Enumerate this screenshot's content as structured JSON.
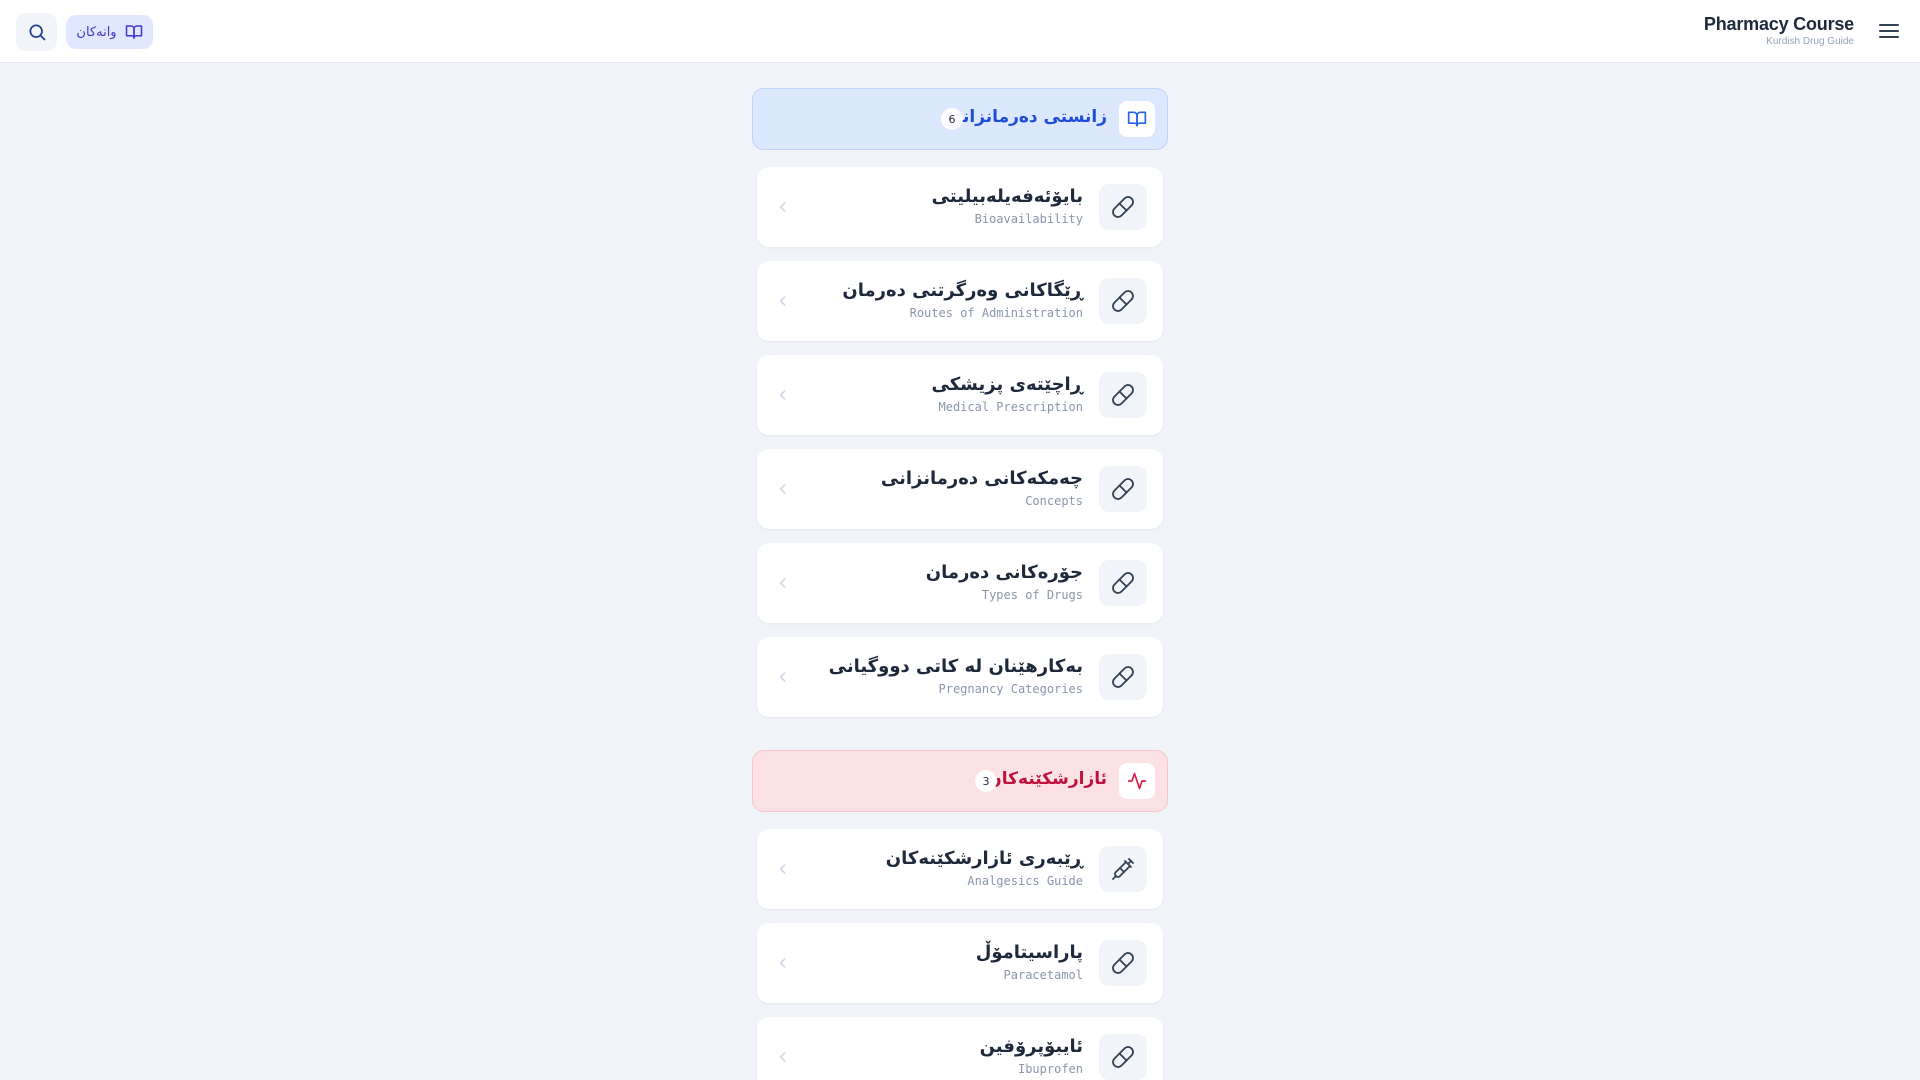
{
  "header": {
    "title": "Pharmacy Course",
    "subtitle": "Kurdish Drug Guide",
    "menu_icon": "hamburger-menu-icon",
    "lessons_label": "وانەکان",
    "lessons_icon": "open-book-icon",
    "search_icon": "search-icon"
  },
  "sections": [
    {
      "title": "زانستی دەرمانزانی",
      "count": "6",
      "icon": "open-book-icon",
      "theme_color": "#1d4ed8",
      "items": [
        {
          "title": "بایۆئەفەیلەبیلیتی",
          "subtitle": "Bioavailability",
          "icon": "pill-icon"
        },
        {
          "title": "ڕێگاکانی وەرگرتنی دەرمان",
          "subtitle": "Routes of Administration",
          "icon": "pill-icon"
        },
        {
          "title": "ڕاچێتەی پزیشکی",
          "subtitle": "Medical Prescription",
          "icon": "pill-icon"
        },
        {
          "title": "چەمکەکانی دەرمانزانی",
          "subtitle": "Concepts",
          "icon": "pill-icon"
        },
        {
          "title": "جۆرەکانی دەرمان",
          "subtitle": "Types of Drugs",
          "icon": "pill-icon"
        },
        {
          "title": "بەکارهێنان لە کاتی دووگیانی",
          "subtitle": "Pregnancy Categories",
          "icon": "pill-icon"
        }
      ]
    },
    {
      "title": "ئازارشکێنەکان",
      "count": "3",
      "icon": "activity-pulse-icon",
      "theme_color": "#be123c",
      "items": [
        {
          "title": "ڕێبەری ئازارشکێنەکان",
          "subtitle": "Analgesics Guide",
          "icon": "syringe-icon"
        },
        {
          "title": "پاراسیتامۆڵ",
          "subtitle": "Paracetamol",
          "icon": "pill-icon"
        },
        {
          "title": "ئایبۆپرۆفین",
          "subtitle": "Ibuprofen",
          "icon": "pill-icon"
        }
      ]
    }
  ]
}
